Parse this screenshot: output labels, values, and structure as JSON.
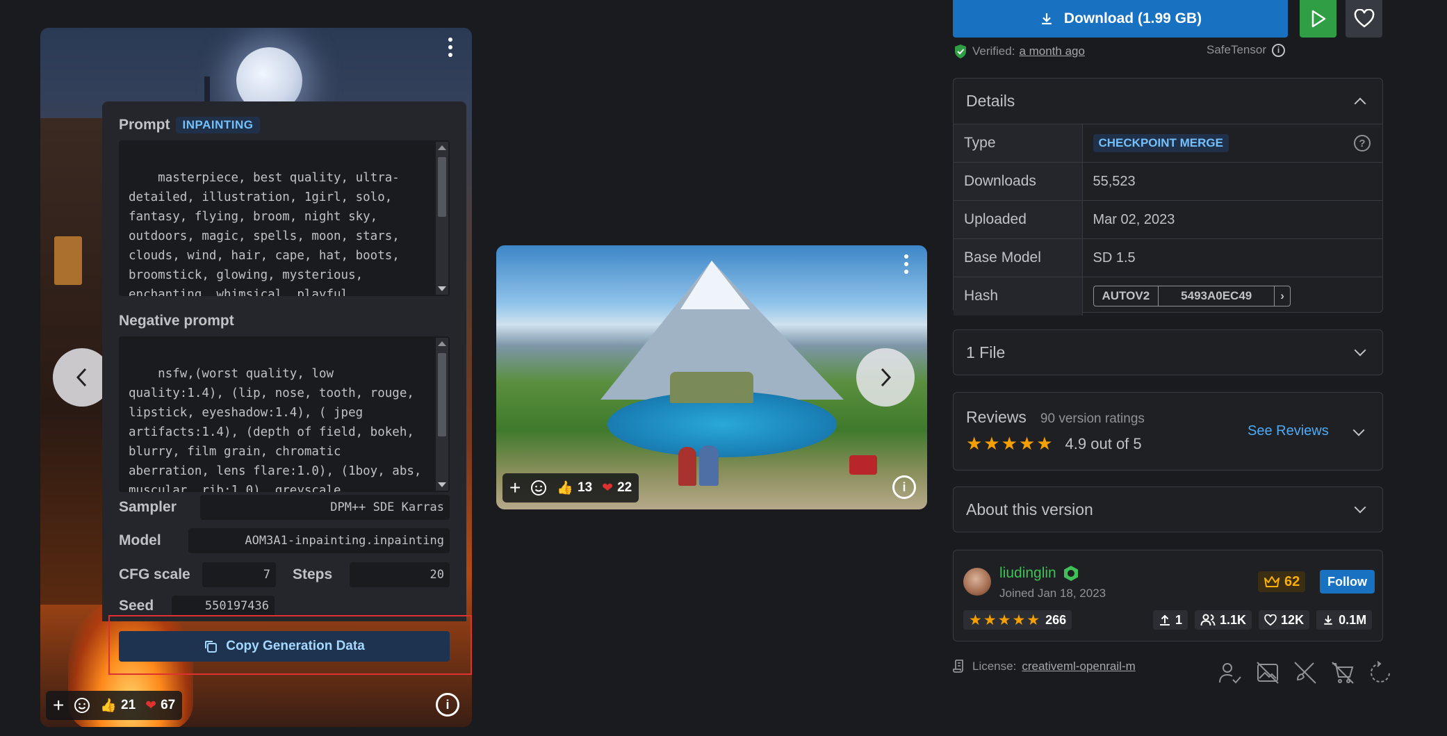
{
  "left_card": {
    "prompt_label": "Prompt",
    "prompt_badge": "INPAINTING",
    "prompt_text": "masterpiece, best quality, ultra-detailed, illustration, 1girl, solo, fantasy, flying, broom, night sky, outdoors, magic, spells, moon, stars, clouds, wind, hair, cape, hat, boots, broomstick, glowing, mysterious, enchanting, whimsical, playful, adventurous, freedom, wonder, imagination, determination, skill, speed",
    "negative_label": "Negative prompt",
    "negative_text": "nsfw,(worst quality, low quality:1.4), (lip, nose, tooth, rouge, lipstick, eyeshadow:1.4), ( jpeg artifacts:1.4), (depth of field, bokeh, blurry, film grain, chromatic aberration, lens flare:1.0), (1boy, abs, muscular, rib:1.0), greyscale, monochrome, dusty sunbeams, trembling, motion lines, motion",
    "sampler_label": "Sampler",
    "sampler_value": "DPM++ SDE Karras",
    "model_label": "Model",
    "model_value": "AOM3A1-inpainting.inpainting",
    "cfg_label": "CFG scale",
    "cfg_value": "7",
    "steps_label": "Steps",
    "steps_value": "20",
    "seed_label": "Seed",
    "seed_value": "550197436",
    "copy_button": "Copy Generation Data",
    "likes": "21",
    "hearts": "67"
  },
  "middle_card": {
    "likes": "13",
    "hearts": "22"
  },
  "actions": {
    "download_label": "Download (1.99 GB)",
    "verified_prefix": "Verified:",
    "verified_time": "a month ago",
    "safetensor": "SafeTensor"
  },
  "details": {
    "title": "Details",
    "rows": [
      {
        "key": "Type",
        "value": "CHECKPOINT MERGE"
      },
      {
        "key": "Downloads",
        "value": "55,523"
      },
      {
        "key": "Uploaded",
        "value": "Mar 02, 2023"
      },
      {
        "key": "Base Model",
        "value": "SD 1.5"
      },
      {
        "key": "Hash",
        "value": "5493A0EC49",
        "algo": "AUTOV2"
      }
    ]
  },
  "files": {
    "title": "1 File"
  },
  "reviews": {
    "title": "Reviews",
    "count": "90 version ratings",
    "score": "4.9 out of 5",
    "rating": 4.9,
    "see_reviews": "See Reviews"
  },
  "about": {
    "title": "About this version"
  },
  "creator": {
    "name": "liudinglin",
    "joined": "Joined Jan 18, 2023",
    "rank": "62",
    "follow": "Follow",
    "rating_count": "266",
    "uploads": "1",
    "followers": "1.1K",
    "favorites": "12K",
    "downloads": "0.1M"
  },
  "license": {
    "prefix": "License:",
    "name": "creativeml-openrail-m"
  },
  "colors": {
    "background": "#1a1b1e",
    "primary": "#1971c2",
    "green": "#2f9e44",
    "star": "#f59f00",
    "badge": "#74c0fc"
  }
}
